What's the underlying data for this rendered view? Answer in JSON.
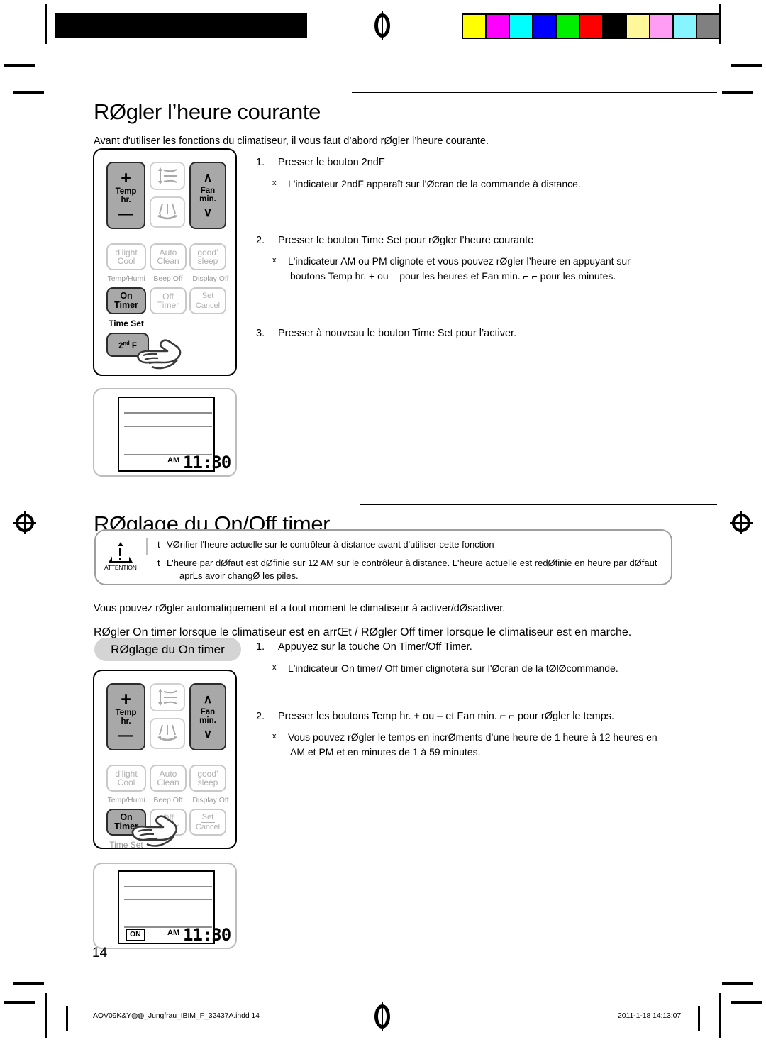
{
  "document": {
    "page_number": "14",
    "footer_left": "AQV09K&Y◍◍_Jungfrau_IBIM_F_32437A.indd   14",
    "footer_right": "2011-1-18   14:13:07"
  },
  "print_marks": {
    "color_bar_colors": [
      "#ffff00",
      "#ff00ff",
      "#00ffff",
      "#0000ff",
      "#00ee00",
      "#ff0000",
      "#000000",
      "#fff79a",
      "#ff9cf3",
      "#86f5ff",
      "#808080"
    ]
  },
  "section1": {
    "title": "RØgler l’heure courante",
    "intro": "Avant d'utiliser les fonctions du climatiseur, il vous faut d’abord rØgler l’heure courante.",
    "steps": [
      {
        "num": "1.",
        "text": "Presser le bouton 2ndF",
        "bullets": [
          {
            "marker": "x",
            "lines": [
              "L'indicateur 2ndF apparaît sur l’Øcran de la commande à distance."
            ]
          }
        ]
      },
      {
        "num": "2.",
        "text": "Presser le bouton Time Set pour rØgler l’heure courante",
        "bullets": [
          {
            "marker": "x",
            "lines": [
              "L'indicateur AM ou PM clignote et vous pouvez rØgler l’heure en appuyant sur",
              "boutons Temp hr. + ou – pour les heures et Fan min. ⌐ ⌐ pour les minutes."
            ]
          }
        ]
      },
      {
        "num": "3.",
        "text": "Presser à nouveau le bouton Time Set pour l’activer.",
        "bullets": []
      }
    ],
    "lcd": {
      "ampm": "AM",
      "time": "11:30"
    }
  },
  "section2": {
    "title": "RØglage du On/Off timer",
    "attention": {
      "label": "ATTENTION",
      "lines": [
        {
          "marker": "t",
          "lines": [
            "VØrifier l'heure actuelle sur le contrôleur à distance avant d'utiliser cette fonction"
          ]
        },
        {
          "marker": "t",
          "lines": [
            "L'heure par dØfaut est dØfinie sur 12 AM sur le contrôleur à distance. L'heure actuelle est redØfinie en heure par dØfaut",
            "aprLs avoir changØ les piles."
          ]
        }
      ]
    },
    "paragraph": "Vous pouvez rØgler automatiquement et a tout moment le climatiseur à activer/dØsactiver.",
    "bold_line": "RØgler On timer  lorsque le climatiseur est en arrŒt / RØgler Off timer lorsque le climatiseur est en marche.",
    "badge": "RØglage du On timer",
    "steps": [
      {
        "num": "1.",
        "text": "Appuyez sur la touche On Timer/Off Timer.",
        "bullets": [
          {
            "marker": "x",
            "lines": [
              "L'indicateur On timer/ Off timer clignotera sur l'Øcran de la tØlØcommande."
            ]
          }
        ]
      },
      {
        "num": "2.",
        "text": "Presser les boutons Temp hr. + ou – et Fan min. ⌐ ⌐ pour rØgler le temps.",
        "bullets": [
          {
            "marker": "x",
            "lines": [
              "Vous pouvez rØgler le temps en incrØments d’une heure de 1 heure à 12 heures en",
              "AM et PM et en minutes de 1 à 59 minutes."
            ]
          }
        ]
      }
    ],
    "lcd": {
      "on_indicator": "ON",
      "ampm": "AM",
      "time": "11:30"
    }
  },
  "remote": {
    "buttons": {
      "temp_plus": "+",
      "temp_minus": "—",
      "temp_label_line1": "Temp",
      "temp_label_line2": "hr.",
      "fan_up": "∧",
      "fan_down": "∨",
      "fan_label_line1": "Fan",
      "fan_label_line2": "min.",
      "dlight_line1": "d’light",
      "dlight_line2": "Cool",
      "autoclean_line1": "Auto",
      "autoclean_line2": "Clean",
      "goodsleep_line1": "good’",
      "goodsleep_line2": "sleep",
      "on_timer_line1": "On",
      "on_timer_line2": "Timer",
      "off_timer_line1": "Off",
      "off_timer_line2": "Timer",
      "set_cancel_top": "Set",
      "set_cancel_bottom": "Cancel",
      "second_f": "2",
      "second_f_sup": "nd",
      "second_f_tail": "F"
    },
    "sublabels": {
      "temp_humi": "Temp/Humi",
      "beep_off": "Beep Off",
      "display_off": "Display Off",
      "time_set": "Time Set"
    }
  }
}
